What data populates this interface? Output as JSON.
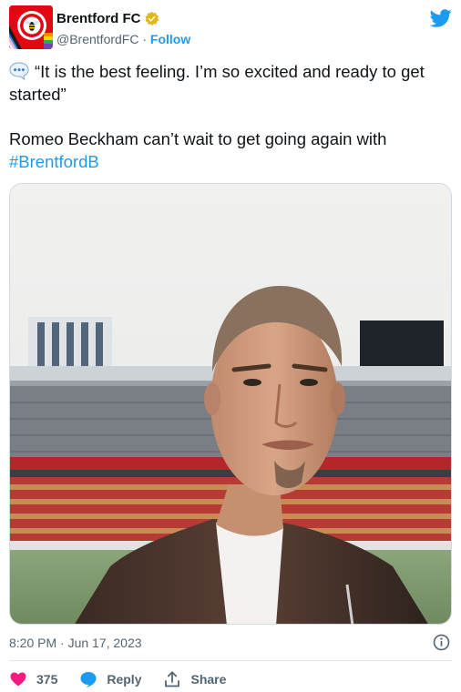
{
  "account": {
    "display_name": "Brentford FC",
    "handle": "@BrentfordFC",
    "separator": "·",
    "follow_label": "Follow",
    "verified_icon": "gold-verified-badge",
    "avatar_icon": "brentford-crest-avatar"
  },
  "tweet": {
    "quote": "“It is the best feeling. I’m so excited and ready to get started”",
    "body": "Romeo Beckham can’t wait to get going again with",
    "hashtag": "#BrentfordB",
    "emoji_icon": "speech-balloon-icon"
  },
  "media": {
    "type": "video-still",
    "description_icon": "player-portrait-stadium-image"
  },
  "meta": {
    "timestamp": "8:20 PM · Jun 17, 2023",
    "info_icon": "info-icon"
  },
  "actions": {
    "like_count": "375",
    "reply_label": "Reply",
    "share_label": "Share"
  },
  "colors": {
    "link": "#1d9bf0",
    "text": "#0f1419",
    "muted": "#536471",
    "like": "#f91880",
    "brand_red": "#e30613"
  }
}
